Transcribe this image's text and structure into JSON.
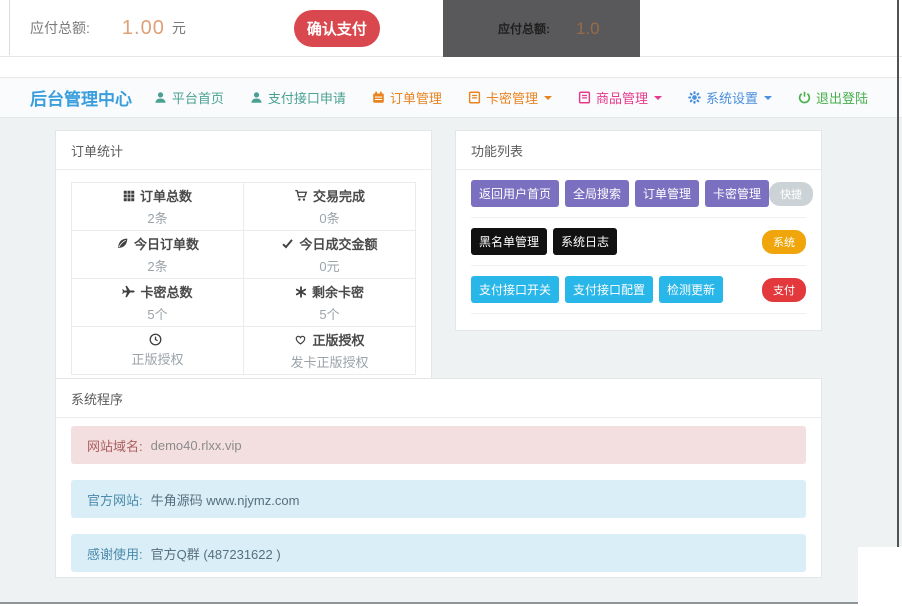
{
  "colors": {
    "brand_blue": "#3a9edd",
    "confirm_red": "#d9484e",
    "amount_orange": "#dfa077",
    "overlay_dark": "#59595b",
    "purple_button": "#7b6fc0",
    "black_button": "#111111",
    "cyan_button": "#29b6e8",
    "quick_badge_gray": "#ccd3d6",
    "system_badge_yellow": "#f0a60a",
    "payment_badge_red": "#e4393c",
    "pink_alert_bg": "#f4dfe0",
    "blue_alert_bg": "#daeef7"
  },
  "payment_bar": {
    "label": "应付总额:",
    "amount": "1.00",
    "unit": "元",
    "confirm_button": "确认支付",
    "overlay": {
      "label": "应付总额:",
      "amount": "1.0"
    }
  },
  "navbar": {
    "brand": "后台管理中心",
    "items": [
      {
        "label": "平台首页",
        "icon": "user-icon"
      },
      {
        "label": "支付接口申请",
        "icon": "user-icon"
      },
      {
        "label": "订单管理",
        "icon": "calendar-icon"
      },
      {
        "label": "卡密管理",
        "icon": "book-icon",
        "dropdown": true
      },
      {
        "label": "商品管理",
        "icon": "book-icon",
        "dropdown": true
      },
      {
        "label": "系统设置",
        "icon": "gear-icon",
        "dropdown": true
      },
      {
        "label": "退出登陆",
        "icon": "logout-icon"
      }
    ]
  },
  "order_stats": {
    "title": "订单统计",
    "cells": [
      {
        "icon": "grid-icon",
        "label": "订单总数",
        "value": "2条"
      },
      {
        "icon": "cart-icon",
        "label": "交易完成",
        "value": "0条"
      },
      {
        "icon": "leaf-icon",
        "label": "今日订单数",
        "value": "2条"
      },
      {
        "icon": "check-icon",
        "label": "今日成交金额",
        "value": "0元"
      },
      {
        "icon": "plane-icon",
        "label": "卡密总数",
        "value": "5个"
      },
      {
        "icon": "asterisk-icon",
        "label": "剩余卡密",
        "value": "5个"
      },
      {
        "icon": "clock-icon",
        "label": "",
        "value": "正版授权"
      },
      {
        "icon": "heart-icon",
        "label": "正版授权",
        "value": "发卡正版授权"
      }
    ]
  },
  "function_list": {
    "title": "功能列表",
    "rows": [
      {
        "style": "purple",
        "tag": "快捷",
        "buttons": [
          "返回用户首页",
          "全局搜索",
          "订单管理",
          "卡密管理"
        ]
      },
      {
        "style": "black",
        "tag": "系统",
        "buttons": [
          "黑名单管理",
          "系统日志"
        ]
      },
      {
        "style": "cyan",
        "tag": "支付",
        "buttons": [
          "支付接口开关",
          "支付接口配置",
          "检测更新"
        ]
      }
    ]
  },
  "system_info": {
    "title": "系统程序",
    "alerts": [
      {
        "type": "pink",
        "label": "网站域名:",
        "text": "demo40.rlxx.vip"
      },
      {
        "type": "blue",
        "label": "官方网站:",
        "text": "牛角源码 www.njymz.com"
      },
      {
        "type": "blue",
        "label": "感谢使用:",
        "text": "官方Q群 (487231622 )"
      }
    ]
  }
}
